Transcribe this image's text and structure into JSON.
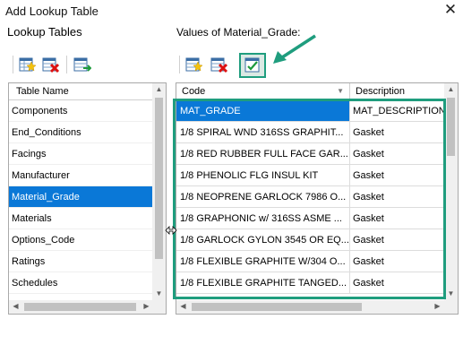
{
  "window": {
    "title": "Add Lookup Table",
    "close_label": "✕"
  },
  "left": {
    "header": "Lookup Tables",
    "column_header": "Table Name",
    "items": [
      "Components",
      "End_Conditions",
      "Facings",
      "Manufacturer",
      "Material_Grade",
      "Materials",
      "Options_Code",
      "Ratings",
      "Schedules"
    ],
    "selected_index": 4
  },
  "right": {
    "header": "Values of Material_Grade:",
    "columns": {
      "code": "Code",
      "description": "Description"
    },
    "rows": [
      {
        "code": "MAT_GRADE",
        "description": "MAT_DESCRIPTION"
      },
      {
        "code": "1/8 SPIRAL WND 316SS GRAPHIT...",
        "description": "Gasket"
      },
      {
        "code": "1/8 RED RUBBER FULL FACE GAR...",
        "description": "Gasket"
      },
      {
        "code": "1/8 PHENOLIC FLG INSUL KIT",
        "description": "Gasket"
      },
      {
        "code": "1/8 NEOPRENE GARLOCK 7986 O...",
        "description": "Gasket"
      },
      {
        "code": "1/8 GRAPHONIC w/ 316SS ASME ...",
        "description": "Gasket"
      },
      {
        "code": "1/8 GARLOCK GYLON 3545 OR EQ...",
        "description": "Gasket"
      },
      {
        "code": "1/8 FLEXIBLE GRAPHITE W/304 O...",
        "description": "Gasket"
      },
      {
        "code": "1/8 FLEXIBLE GRAPHITE TANGED...",
        "description": "Gasket"
      }
    ],
    "selected_row": 0
  },
  "toolbar_icons": {
    "left": [
      "add-table-icon",
      "delete-table-icon",
      "add-column-icon"
    ],
    "right": [
      "add-row-icon",
      "delete-row-icon",
      "edit-grid-icon"
    ]
  },
  "colors": {
    "selection": "#0a78d7",
    "highlight": "#1f9d7e"
  }
}
